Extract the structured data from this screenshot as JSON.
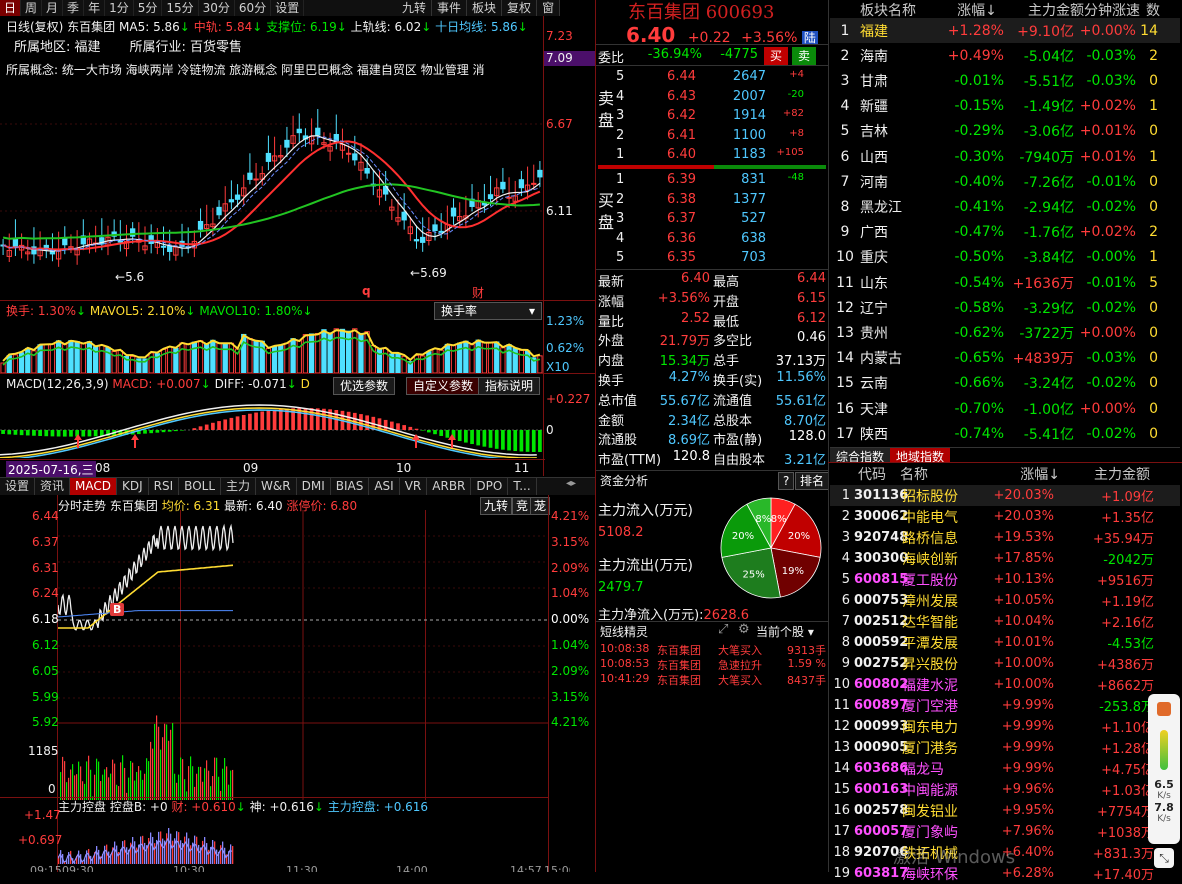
{
  "period_tabs": [
    "日",
    "周",
    "月",
    "季",
    "年",
    "1分",
    "5分",
    "15分",
    "30分",
    "60分",
    "设置"
  ],
  "right_tabs_top": [
    "九转",
    "事件",
    "板块",
    "复权",
    "窗"
  ],
  "kline_info": {
    "head": "日线(复权) 东百集团",
    "ma5": "MA5: 5.86",
    "ma5_arrow": "↓",
    "mid": "中轨: 5.84",
    "mid_arrow": "↓",
    "support": "支撑位: 6.19",
    "support_arrow": "↓",
    "upper": "上轨线: 6.02",
    "upper_arrow": "↓",
    "ten": "十日均线: 5.86",
    "ten_arrow": "↓"
  },
  "region_line": "所属地区: 福建       所属行业: 百货零售",
  "concept_line": "所属概念: 统一大市场  海峡两岸  冷链物流  旅游概念  阿里巴巴概念  福建自贸区  物业管理  消",
  "kline_price_labels": [
    "7.23",
    "7.09",
    "6.67",
    "6.11"
  ],
  "kline_marks": {
    "low1": "5.6",
    "low2": "5.69",
    "q": "q",
    "cai": "财"
  },
  "turnover": {
    "label": "换手: 1.30%",
    "label_arrow": "↓",
    "mavol5": "MAVOL5: 2.10%",
    "mavol5_arrow": "↓",
    "mavol10": "MAVOL10: 1.80%",
    "mavol10_arrow": "↓",
    "select": "换手率",
    "scale": [
      "1.23%",
      "0.62%",
      "X10"
    ]
  },
  "macd": {
    "label": "MACD(12,26,3,9)",
    "macd": "MACD: +0.007",
    "macd_arrow": "↓",
    "diff": "DIFF: -0.071",
    "diff_arrow": "↓",
    "tail": "D",
    "scale": [
      "+0.227",
      "0"
    ],
    "buttons": [
      "优选参数",
      "自定义参数",
      "指标说明"
    ]
  },
  "date_axis": {
    "start": "2025-07-16,三",
    "labels": [
      "08",
      "09",
      "10",
      "11"
    ]
  },
  "indicator_tabs": [
    "设置",
    "资讯",
    "MACD",
    "KDJ",
    "RSI",
    "BOLL",
    "主力",
    "W&R",
    "DMI",
    "BIAS",
    "ASI",
    "VR",
    "ARBR",
    "DPO",
    "T..."
  ],
  "intraday": {
    "title": "分时走势",
    "name": "东百集团",
    "avg": "均价: 6.31",
    "latest": "最新: 6.40",
    "limit": "涨停价: 6.80",
    "btns": [
      "九转",
      "竞",
      "茏"
    ],
    "prices": [
      "6.44",
      "6.37",
      "6.31",
      "6.24",
      "6.18",
      "6.12",
      "6.05",
      "5.99",
      "5.92"
    ],
    "pcts": [
      "4.21%",
      "3.15%",
      "2.09%",
      "1.04%",
      "0.00%",
      "1.04%",
      "2.09%",
      "3.15%",
      "4.21%"
    ],
    "vol_labels": [
      "1185",
      "0"
    ],
    "b_mark": "B"
  },
  "control": {
    "label": "主力控盘",
    "kpB": "控盘B: +0",
    "cai": "财: +0.610",
    "cai_arrow": "↓",
    "shen": "神: +0.616",
    "shen_arrow": "↓",
    "main": "主力控盘: +0.616",
    "scale": [
      "+1.47",
      "+0.697"
    ],
    "times": [
      "09:15",
      "09:30",
      "10:30",
      "11:30",
      "14:00",
      "14:57",
      "15:00"
    ]
  },
  "stock_header": {
    "name": "东百集团 600693",
    "price": "6.40",
    "chg": "+0.22",
    "pct": "+3.56%",
    "lu": "陆"
  },
  "weibi": {
    "label": "委比",
    "ratio": "-36.94%",
    "diff": "-4775",
    "buy": "买",
    "sell": "卖"
  },
  "sell_side": "卖盘",
  "buy_side": "买盘",
  "sell_orders": [
    {
      "lv": "5",
      "p": "6.44",
      "v": "2647",
      "d": "+4"
    },
    {
      "lv": "4",
      "p": "6.43",
      "v": "2007",
      "d": "-20"
    },
    {
      "lv": "3",
      "p": "6.42",
      "v": "1914",
      "d": "+82"
    },
    {
      "lv": "2",
      "p": "6.41",
      "v": "1100",
      "d": "+8"
    },
    {
      "lv": "1",
      "p": "6.40",
      "v": "1183",
      "d": "+105"
    }
  ],
  "buy_orders": [
    {
      "lv": "1",
      "p": "6.39",
      "v": "831",
      "d": "-48"
    },
    {
      "lv": "2",
      "p": "6.38",
      "v": "1377",
      "d": ""
    },
    {
      "lv": "3",
      "p": "6.37",
      "v": "527",
      "d": ""
    },
    {
      "lv": "4",
      "p": "6.36",
      "v": "638",
      "d": ""
    },
    {
      "lv": "5",
      "p": "6.35",
      "v": "703",
      "d": ""
    }
  ],
  "quote": [
    [
      "最新",
      "6.40",
      "最高",
      "6.44"
    ],
    [
      "涨幅",
      "+3.56%",
      "开盘",
      "6.15"
    ],
    [
      "量比",
      "2.52",
      "最低",
      "6.12"
    ],
    [
      "外盘",
      "21.79万",
      "多空比",
      "0.46"
    ],
    [
      "内盘",
      "15.34万",
      "总手",
      "37.13万"
    ],
    [
      "换手",
      "4.27%",
      "换手(实)",
      "11.56%"
    ],
    [
      "总市值",
      "55.67亿",
      "流通值",
      "55.61亿"
    ],
    [
      "金额",
      "2.34亿",
      "总股本",
      "8.70亿"
    ],
    [
      "流通股",
      "8.69亿",
      "市盈(静)",
      "128.0"
    ],
    [
      "市盈(TTM)",
      "120.8",
      "自由股本",
      "3.21亿"
    ]
  ],
  "fund": {
    "title": "资金分析",
    "q": "?",
    "rank": "排名",
    "in_label": "主力流入(万元)",
    "in_val": "5108.2",
    "out_label": "主力流出(万元)",
    "out_val": "2479.7",
    "net_label": "主力净流入(万元):",
    "net_val": "2628.6",
    "pie": [
      {
        "pct": "8%",
        "v": 8,
        "c": "#ff2020"
      },
      {
        "pct": "20%",
        "v": 20,
        "c": "#c00000"
      },
      {
        "pct": "19%",
        "v": 19,
        "c": "#700000"
      },
      {
        "pct": "25%",
        "v": 25,
        "c": "#1e7d1e"
      },
      {
        "pct": "20%",
        "v": 20,
        "c": "#0a9a0a"
      },
      {
        "pct": "8%",
        "v": 8,
        "c": "#29b829"
      }
    ]
  },
  "short_line": {
    "title": "短线精灵",
    "scope": "当前个股",
    "rows": [
      [
        "10:08:38",
        "东百集团",
        "大笔买入",
        "9313手"
      ],
      [
        "10:08:53",
        "东百集团",
        "急速拉升",
        "1.59 %"
      ],
      [
        "10:41:29",
        "东百集团",
        "大笔买入",
        "8437手"
      ]
    ]
  },
  "sector_header": [
    "板块名称",
    "涨幅↓",
    "主力金额",
    "分钟涨速",
    "数"
  ],
  "sectors": [
    [
      "1",
      "福建",
      "+1.28%",
      "+9.10亿",
      "+0.00%",
      "14"
    ],
    [
      "2",
      "海南",
      "+0.49%",
      "-5.04亿",
      "-0.03%",
      "2"
    ],
    [
      "3",
      "甘肃",
      "-0.01%",
      "-5.51亿",
      "-0.03%",
      "0"
    ],
    [
      "4",
      "新疆",
      "-0.15%",
      "-1.49亿",
      "+0.02%",
      "1"
    ],
    [
      "5",
      "吉林",
      "-0.29%",
      "-3.06亿",
      "+0.01%",
      "0"
    ],
    [
      "6",
      "山西",
      "-0.30%",
      "-7940万",
      "+0.01%",
      "1"
    ],
    [
      "7",
      "河南",
      "-0.40%",
      "-7.26亿",
      "-0.01%",
      "0"
    ],
    [
      "8",
      "黑龙江",
      "-0.41%",
      "-2.94亿",
      "-0.02%",
      "0"
    ],
    [
      "9",
      "广西",
      "-0.47%",
      "-1.76亿",
      "+0.02%",
      "2"
    ],
    [
      "10",
      "重庆",
      "-0.50%",
      "-3.84亿",
      "-0.00%",
      "1"
    ],
    [
      "11",
      "山东",
      "-0.54%",
      "+1636万",
      "-0.01%",
      "5"
    ],
    [
      "12",
      "辽宁",
      "-0.58%",
      "-3.29亿",
      "-0.02%",
      "0"
    ],
    [
      "13",
      "贵州",
      "-0.62%",
      "-3722万",
      "+0.00%",
      "0"
    ],
    [
      "14",
      "内蒙古",
      "-0.65%",
      "+4839万",
      "-0.03%",
      "0"
    ],
    [
      "15",
      "云南",
      "-0.66%",
      "-3.24亿",
      "-0.02%",
      "0"
    ],
    [
      "16",
      "天津",
      "-0.70%",
      "-1.00亿",
      "+0.00%",
      "0"
    ],
    [
      "17",
      "陕西",
      "-0.74%",
      "-5.41亿",
      "-0.02%",
      "0"
    ]
  ],
  "sector_tabs": [
    "综合指数",
    "地域指数"
  ],
  "stock_list_header": [
    "代码",
    "名称",
    "涨幅↓",
    "主力金额"
  ],
  "stocks": [
    [
      "1",
      "301136",
      "招标股份",
      "+20.03%",
      "+1.09亿"
    ],
    [
      "2",
      "300062",
      "中能电气",
      "+20.03%",
      "+1.35亿"
    ],
    [
      "3",
      "920748",
      "路桥信息",
      "+19.53%",
      "+35.94万"
    ],
    [
      "4",
      "300300",
      "海峡创新",
      "+17.85%",
      "-2042万"
    ],
    [
      "5",
      "600815",
      "厦工股份",
      "+10.13%",
      "+9516万"
    ],
    [
      "6",
      "000753",
      "漳州发展",
      "+10.05%",
      "+1.19亿"
    ],
    [
      "7",
      "002512",
      "达华智能",
      "+10.04%",
      "+2.16亿"
    ],
    [
      "8",
      "000592",
      "平潭发展",
      "+10.01%",
      "-4.53亿"
    ],
    [
      "9",
      "002752",
      "昇兴股份",
      "+10.00%",
      "+4386万"
    ],
    [
      "10",
      "600802",
      "福建水泥",
      "+10.00%",
      "+8662万"
    ],
    [
      "11",
      "600897",
      "厦门空港",
      "+9.99%",
      "-253.8万"
    ],
    [
      "12",
      "000993",
      "闽东电力",
      "+9.99%",
      "+1.10亿"
    ],
    [
      "13",
      "000905",
      "厦门港务",
      "+9.99%",
      "+1.28亿"
    ],
    [
      "14",
      "603686",
      "福龙马",
      "+9.99%",
      "+4.75亿"
    ],
    [
      "15",
      "600163",
      "中闽能源",
      "+9.96%",
      "+1.03亿"
    ],
    [
      "16",
      "002578",
      "闽发铝业",
      "+9.95%",
      "+7754万"
    ],
    [
      "17",
      "600057",
      "厦门象屿",
      "+7.96%",
      "+1038万"
    ],
    [
      "18",
      "920706",
      "铁拓机械",
      "+6.40%",
      "+831.3万"
    ],
    [
      "19",
      "603817",
      "海峡环保",
      "+6.28%",
      "+17.40万"
    ]
  ],
  "watermark": "激活 Windows",
  "speed_widget": {
    "main": "6.5",
    "main_unit": "K/s",
    "up": "7.8",
    "up_unit": "K/s"
  },
  "colors": {
    "up": "#ff3c3c",
    "down": "#00e600",
    "panel_border": "#7a1010",
    "selected_row": "#1c1c1c"
  }
}
